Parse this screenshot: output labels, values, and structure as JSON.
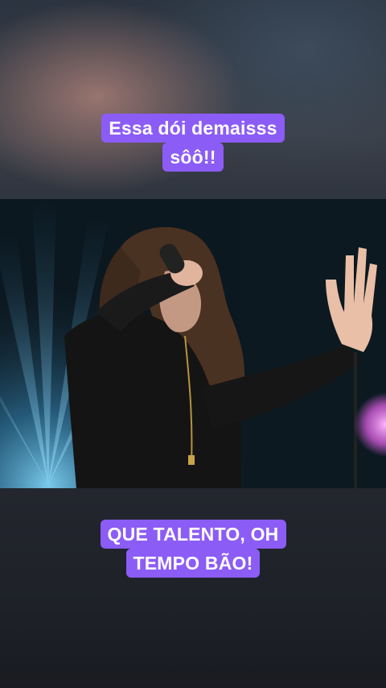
{
  "captions": {
    "top": [
      "Essa dói demaisss",
      "sôô!!"
    ],
    "bottom": [
      "QUE TALENTO, OH",
      "TEMPO BÃO!"
    ]
  },
  "colors": {
    "caption_background": "#8c5cf6",
    "caption_text": "#ffffff",
    "page_background": "#1c1f26"
  }
}
